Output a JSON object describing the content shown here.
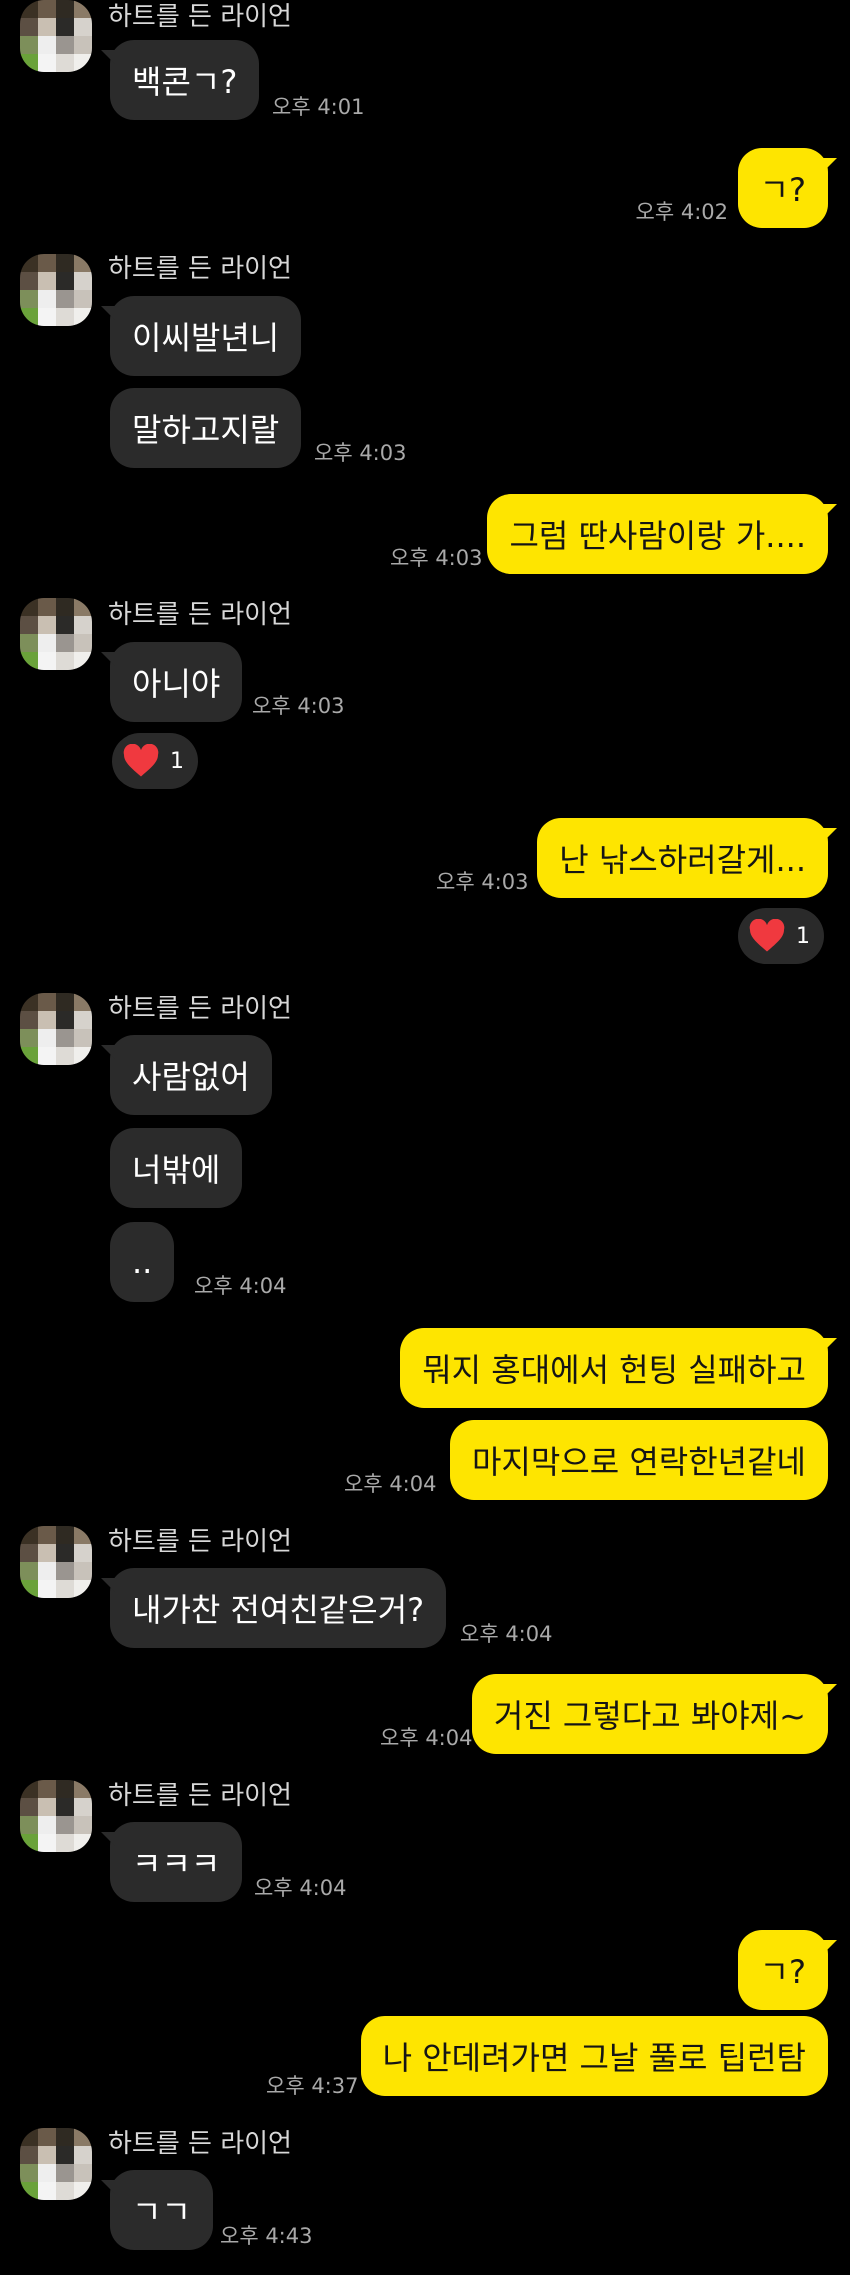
{
  "contact": {
    "name": "하트를 든 라이언"
  },
  "reaction": {
    "icon": "heart-icon",
    "count": "1",
    "color": "#f0393f"
  },
  "colors": {
    "incoming_bubble": "#2b2b2b",
    "outgoing_bubble": "#fee500",
    "background": "#000000"
  },
  "messages": [
    {
      "id": "m1",
      "side": "in",
      "text": "백콘ㄱ?",
      "time": "오후 4:01"
    },
    {
      "id": "m2",
      "side": "out",
      "text": "ㄱ?",
      "time": "오후 4:02"
    },
    {
      "id": "m3",
      "side": "in",
      "text": "이씨발년니",
      "time": ""
    },
    {
      "id": "m4",
      "side": "in",
      "text": "말하고지랄",
      "time": "오후 4:03"
    },
    {
      "id": "m5",
      "side": "out",
      "text": "그럼 딴사람이랑 가....",
      "time": "오후 4:03"
    },
    {
      "id": "m6",
      "side": "in",
      "text": "아니야",
      "time": "오후 4:03"
    },
    {
      "id": "m7",
      "side": "out",
      "text": "난 낚스하러갈게...",
      "time": "오후 4:03"
    },
    {
      "id": "m8",
      "side": "in",
      "text": "사람없어",
      "time": ""
    },
    {
      "id": "m9",
      "side": "in",
      "text": "너밖에",
      "time": ""
    },
    {
      "id": "m10",
      "side": "in",
      "text": "..",
      "time": "오후 4:04"
    },
    {
      "id": "m11",
      "side": "out",
      "text": "뭐지 홍대에서 헌팅 실패하고",
      "time": ""
    },
    {
      "id": "m12",
      "side": "out",
      "text": "마지막으로 연락한년같네",
      "time": "오후 4:04"
    },
    {
      "id": "m13",
      "side": "in",
      "text": "내가찬 전여친같은거?",
      "time": "오후 4:04"
    },
    {
      "id": "m14",
      "side": "out",
      "text": "거진 그렇다고 봐야제~",
      "time": "오후 4:04"
    },
    {
      "id": "m15",
      "side": "in",
      "text": "ㅋㅋㅋ",
      "time": "오후 4:04"
    },
    {
      "id": "m16",
      "side": "out",
      "text": "ㄱ?",
      "time": ""
    },
    {
      "id": "m17",
      "side": "out",
      "text": "나 안데려가면 그날 풀로 팁런탐",
      "time": "오후 4:37"
    },
    {
      "id": "m18",
      "side": "in",
      "text": "ㄱㄱ",
      "time": "오후 4:43"
    }
  ]
}
